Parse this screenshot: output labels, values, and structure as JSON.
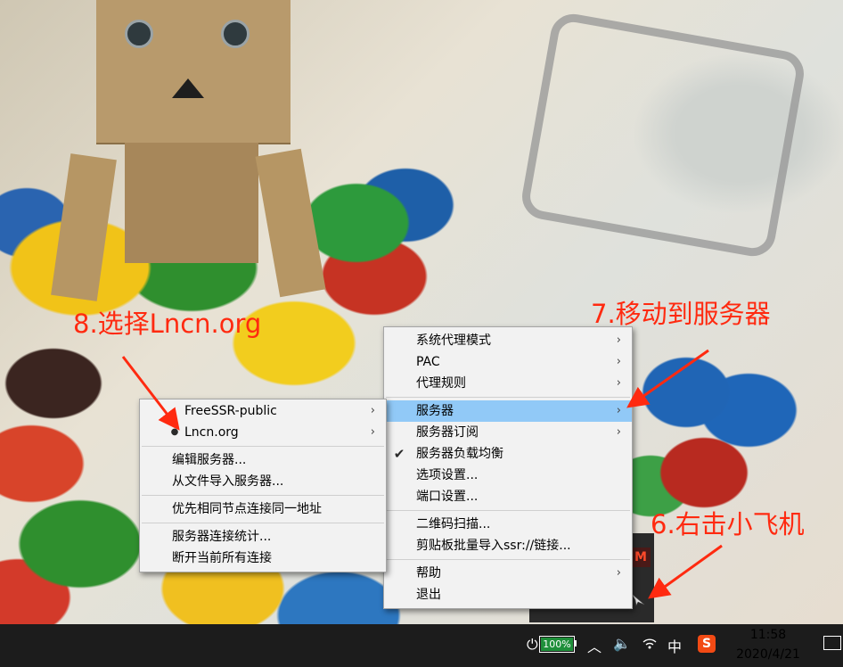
{
  "annotations": {
    "step6": "6.右击小飞机",
    "step7": "7.移动到服务器",
    "step8": "8.选择Lncn.org"
  },
  "main_menu": {
    "items": [
      {
        "label": "系统代理模式",
        "submenu": true
      },
      {
        "label": "PAC",
        "submenu": true
      },
      {
        "label": "代理规则",
        "submenu": true
      },
      {
        "label": "服务器",
        "submenu": true,
        "active": true
      },
      {
        "label": "服务器订阅",
        "submenu": true
      },
      {
        "label": "服务器负载均衡",
        "checked": true
      },
      {
        "label": "选项设置..."
      },
      {
        "label": "端口设置..."
      },
      {
        "label": "二维码扫描..."
      },
      {
        "label": "剪贴板批量导入ssr://链接..."
      },
      {
        "label": "帮助",
        "submenu": true
      },
      {
        "label": "退出"
      }
    ]
  },
  "server_submenu": {
    "items": [
      {
        "label": "FreeSSR-public",
        "submenu": true
      },
      {
        "label": "Lncn.org",
        "submenu": true,
        "selected": true
      },
      {
        "label": "编辑服务器..."
      },
      {
        "label": "从文件导入服务器..."
      },
      {
        "label": "优先相同节点连接同一地址"
      },
      {
        "label": "服务器连接统计..."
      },
      {
        "label": "断开当前所有连接"
      }
    ]
  },
  "tray": {
    "battery_text": "100%",
    "battery_level": 1.0,
    "ime_label": "中",
    "sogou_label": "S",
    "app_badge": "M",
    "plug_icon": "power-plug-icon",
    "up_icon": "chevron-up-icon",
    "volume_icon": "volume-icon",
    "wifi_icon": "wifi-icon",
    "notification_icon": "notification-icon",
    "plane_icon": "paper-plane-icon"
  },
  "clock": {
    "time": "11:58",
    "date": "2020/4/21"
  },
  "colors": {
    "annotation": "#ff2a10",
    "menu_highlight": "#91c9f7",
    "menu_background": "#f2f2f2",
    "taskbar": "#1c1c1c",
    "battery_green": "#1f8f3a"
  }
}
